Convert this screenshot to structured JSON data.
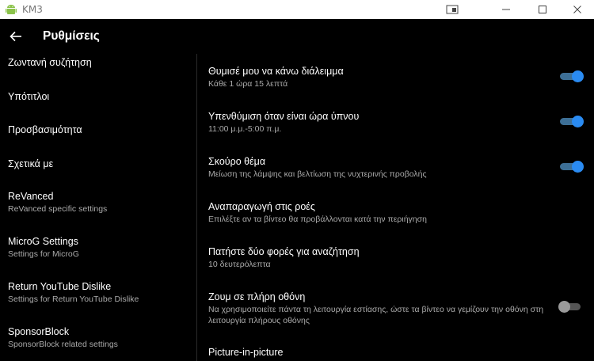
{
  "window": {
    "title": "KM3",
    "icon": "android-icon",
    "controls": [
      "restore-compact-icon",
      "minimize-icon",
      "maximize-icon",
      "close-icon"
    ]
  },
  "header": {
    "title": "Ρυθμίσεις",
    "back_icon": "arrow-left-icon"
  },
  "sidebar": {
    "items": [
      {
        "label": "Ζωντανή συζήτηση",
        "sub": ""
      },
      {
        "label": "Υπότιτλοι",
        "sub": ""
      },
      {
        "label": "Προσβασιμότητα",
        "sub": ""
      },
      {
        "label": "Σχετικά με",
        "sub": ""
      },
      {
        "label": "ReVanced",
        "sub": "ReVanced specific settings"
      },
      {
        "label": "MicroG Settings",
        "sub": "Settings for MicroG"
      },
      {
        "label": "Return YouTube Dislike",
        "sub": "Settings for Return YouTube Dislike"
      },
      {
        "label": "SponsorBlock",
        "sub": "SponsorBlock related settings"
      }
    ]
  },
  "settings": {
    "items": [
      {
        "title": "Θυμισέ μου να κάνω διάλειμμα",
        "sub": "Κάθε 1 ώρα 15 λεπτά",
        "toggle": "on"
      },
      {
        "title": "Υπενθύμιση όταν είναι ώρα ύπνου",
        "sub": "11:00 μ.μ.-5:00 π.μ.",
        "toggle": "on"
      },
      {
        "title": "Σκούρο θέμα",
        "sub": "Μείωση της λάμψης και βελτίωση της νυχτερινής προβολής",
        "toggle": "on"
      },
      {
        "title": "Αναπαραγωγή στις ροές",
        "sub": "Επιλέξτε αν τα βίντεο θα προβάλλονται κατά την περιήγηση",
        "toggle": null
      },
      {
        "title": "Πατήστε δύο φορές για αναζήτηση",
        "sub": "10 δευτερόλεπτα",
        "toggle": null
      },
      {
        "title": "Ζουμ σε πλήρη οθόνη",
        "sub": "Να χρησιμοποιείτε πάντα τη λειτουργία εστίασης, ώστε τα βίντεο να γεμίζουν την οθόνη στη λειτουργία πλήρους οθόνης",
        "toggle": "off"
      },
      {
        "title": "Picture-in-picture",
        "sub": "",
        "toggle": null
      }
    ]
  },
  "colors": {
    "background": "#000000",
    "toggle_on": "#2a8bf2",
    "toggle_off": "#9a9a9a"
  }
}
